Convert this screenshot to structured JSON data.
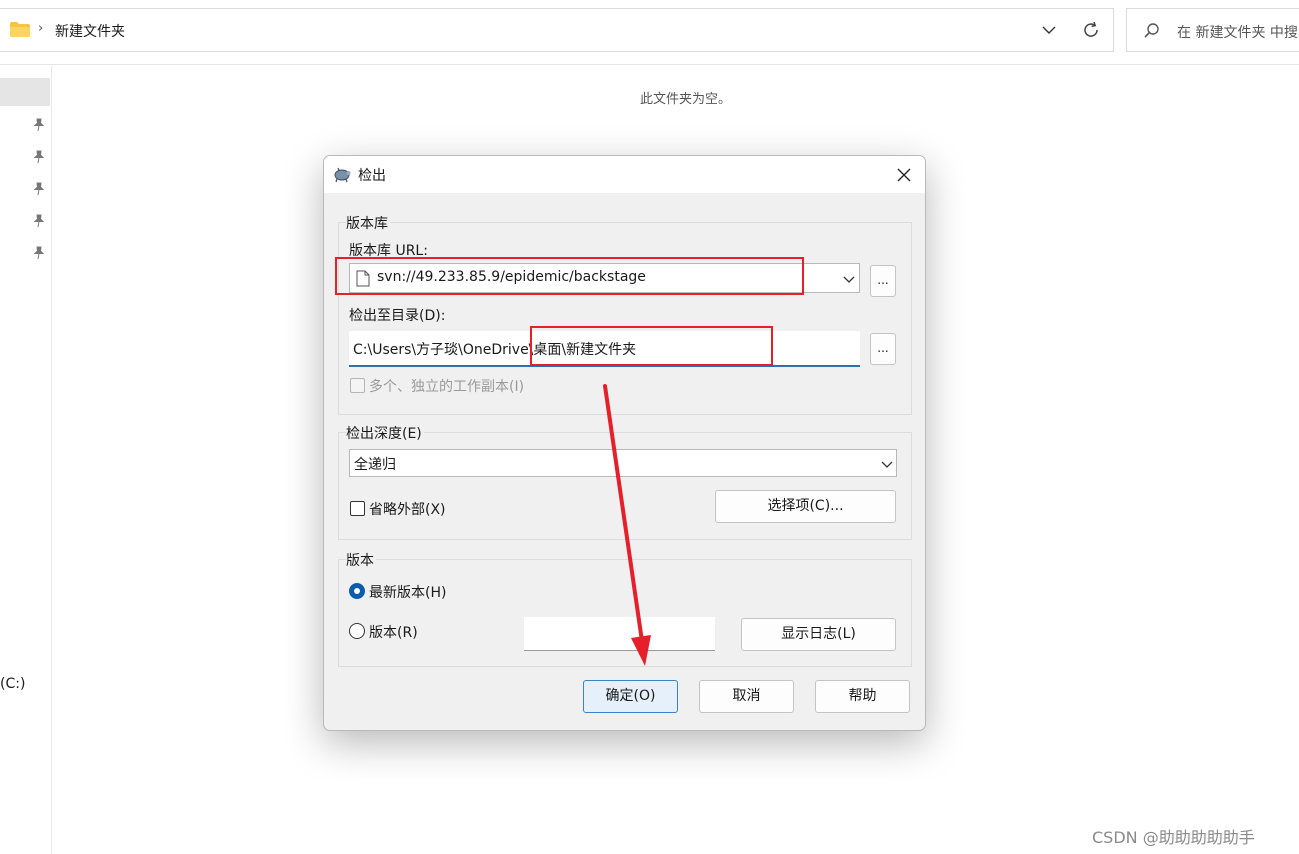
{
  "explorer": {
    "breadcrumb": "新建文件夹",
    "search_placeholder": "在 新建文件夹 中搜",
    "empty_message": "此文件夹为空。",
    "drive_label": "(C:)"
  },
  "dialog": {
    "title": "检出",
    "repository": {
      "group_title": "版本库",
      "url_label": "版本库 URL:",
      "url_value": "svn://49.233.85.9/epidemic/backstage",
      "browse_label": "...",
      "dir_label": "检出至目录(D):",
      "dir_value": "C:\\Users\\方子琰\\OneDrive\\桌面\\新建文件夹",
      "dir_browse_label": "...",
      "multi_copy_label": "多个、独立的工作副本(I)"
    },
    "depth": {
      "group_title": "检出深度(E)",
      "selected": "全递归",
      "omit_externals_label": "省略外部(X)",
      "options_button": "选择项(C)..."
    },
    "revision": {
      "group_title": "版本",
      "head_label": "最新版本(H)",
      "revision_label": "版本(R)",
      "revision_value": "",
      "show_log_button": "显示日志(L)"
    },
    "buttons": {
      "ok": "确定(O)",
      "cancel": "取消",
      "help": "帮助"
    }
  },
  "watermark": "CSDN @助助助助助手",
  "colors": {
    "annotation": "#e5202a",
    "accent": "#0b5cad"
  }
}
